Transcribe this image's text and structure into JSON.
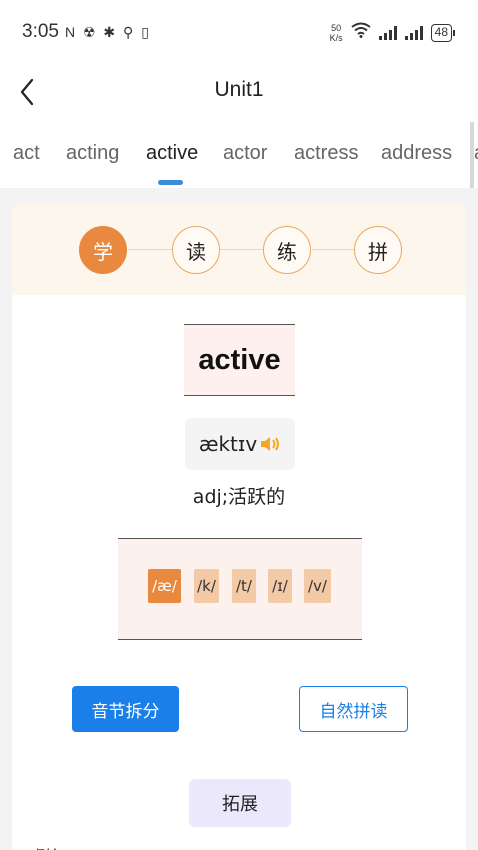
{
  "status_bar": {
    "time": "3:05",
    "left_icons": "N ☢ ✱ ⚲ ▯",
    "net_speed_value": "50",
    "net_speed_unit": "K/s",
    "battery": "48"
  },
  "nav": {
    "title": "Unit1"
  },
  "word_tabs": [
    {
      "label": "act"
    },
    {
      "label": "acting"
    },
    {
      "label": "active"
    },
    {
      "label": "actor"
    },
    {
      "label": "actress"
    },
    {
      "label": "address"
    },
    {
      "label": "a"
    }
  ],
  "active_tab": "active",
  "steps": [
    {
      "label": "学"
    },
    {
      "label": "读"
    },
    {
      "label": "练"
    },
    {
      "label": "拼"
    }
  ],
  "word": {
    "text": "active",
    "phonetic": "ækt​ɪv",
    "meaning": "adj;活跃的"
  },
  "phonemes": [
    {
      "label": "/æ/"
    },
    {
      "label": "/k/"
    },
    {
      "label": "/t/"
    },
    {
      "label": "/ɪ/"
    },
    {
      "label": "/v/"
    }
  ],
  "buttons": {
    "syllable": "音节拆分",
    "phonics": "自然拼读",
    "extend": "拓展"
  },
  "example_label": "例句",
  "colors": {
    "accent_orange": "#e9893f",
    "primary_blue": "#1a7fe8",
    "tab_indicator": "#3b8ed8"
  }
}
